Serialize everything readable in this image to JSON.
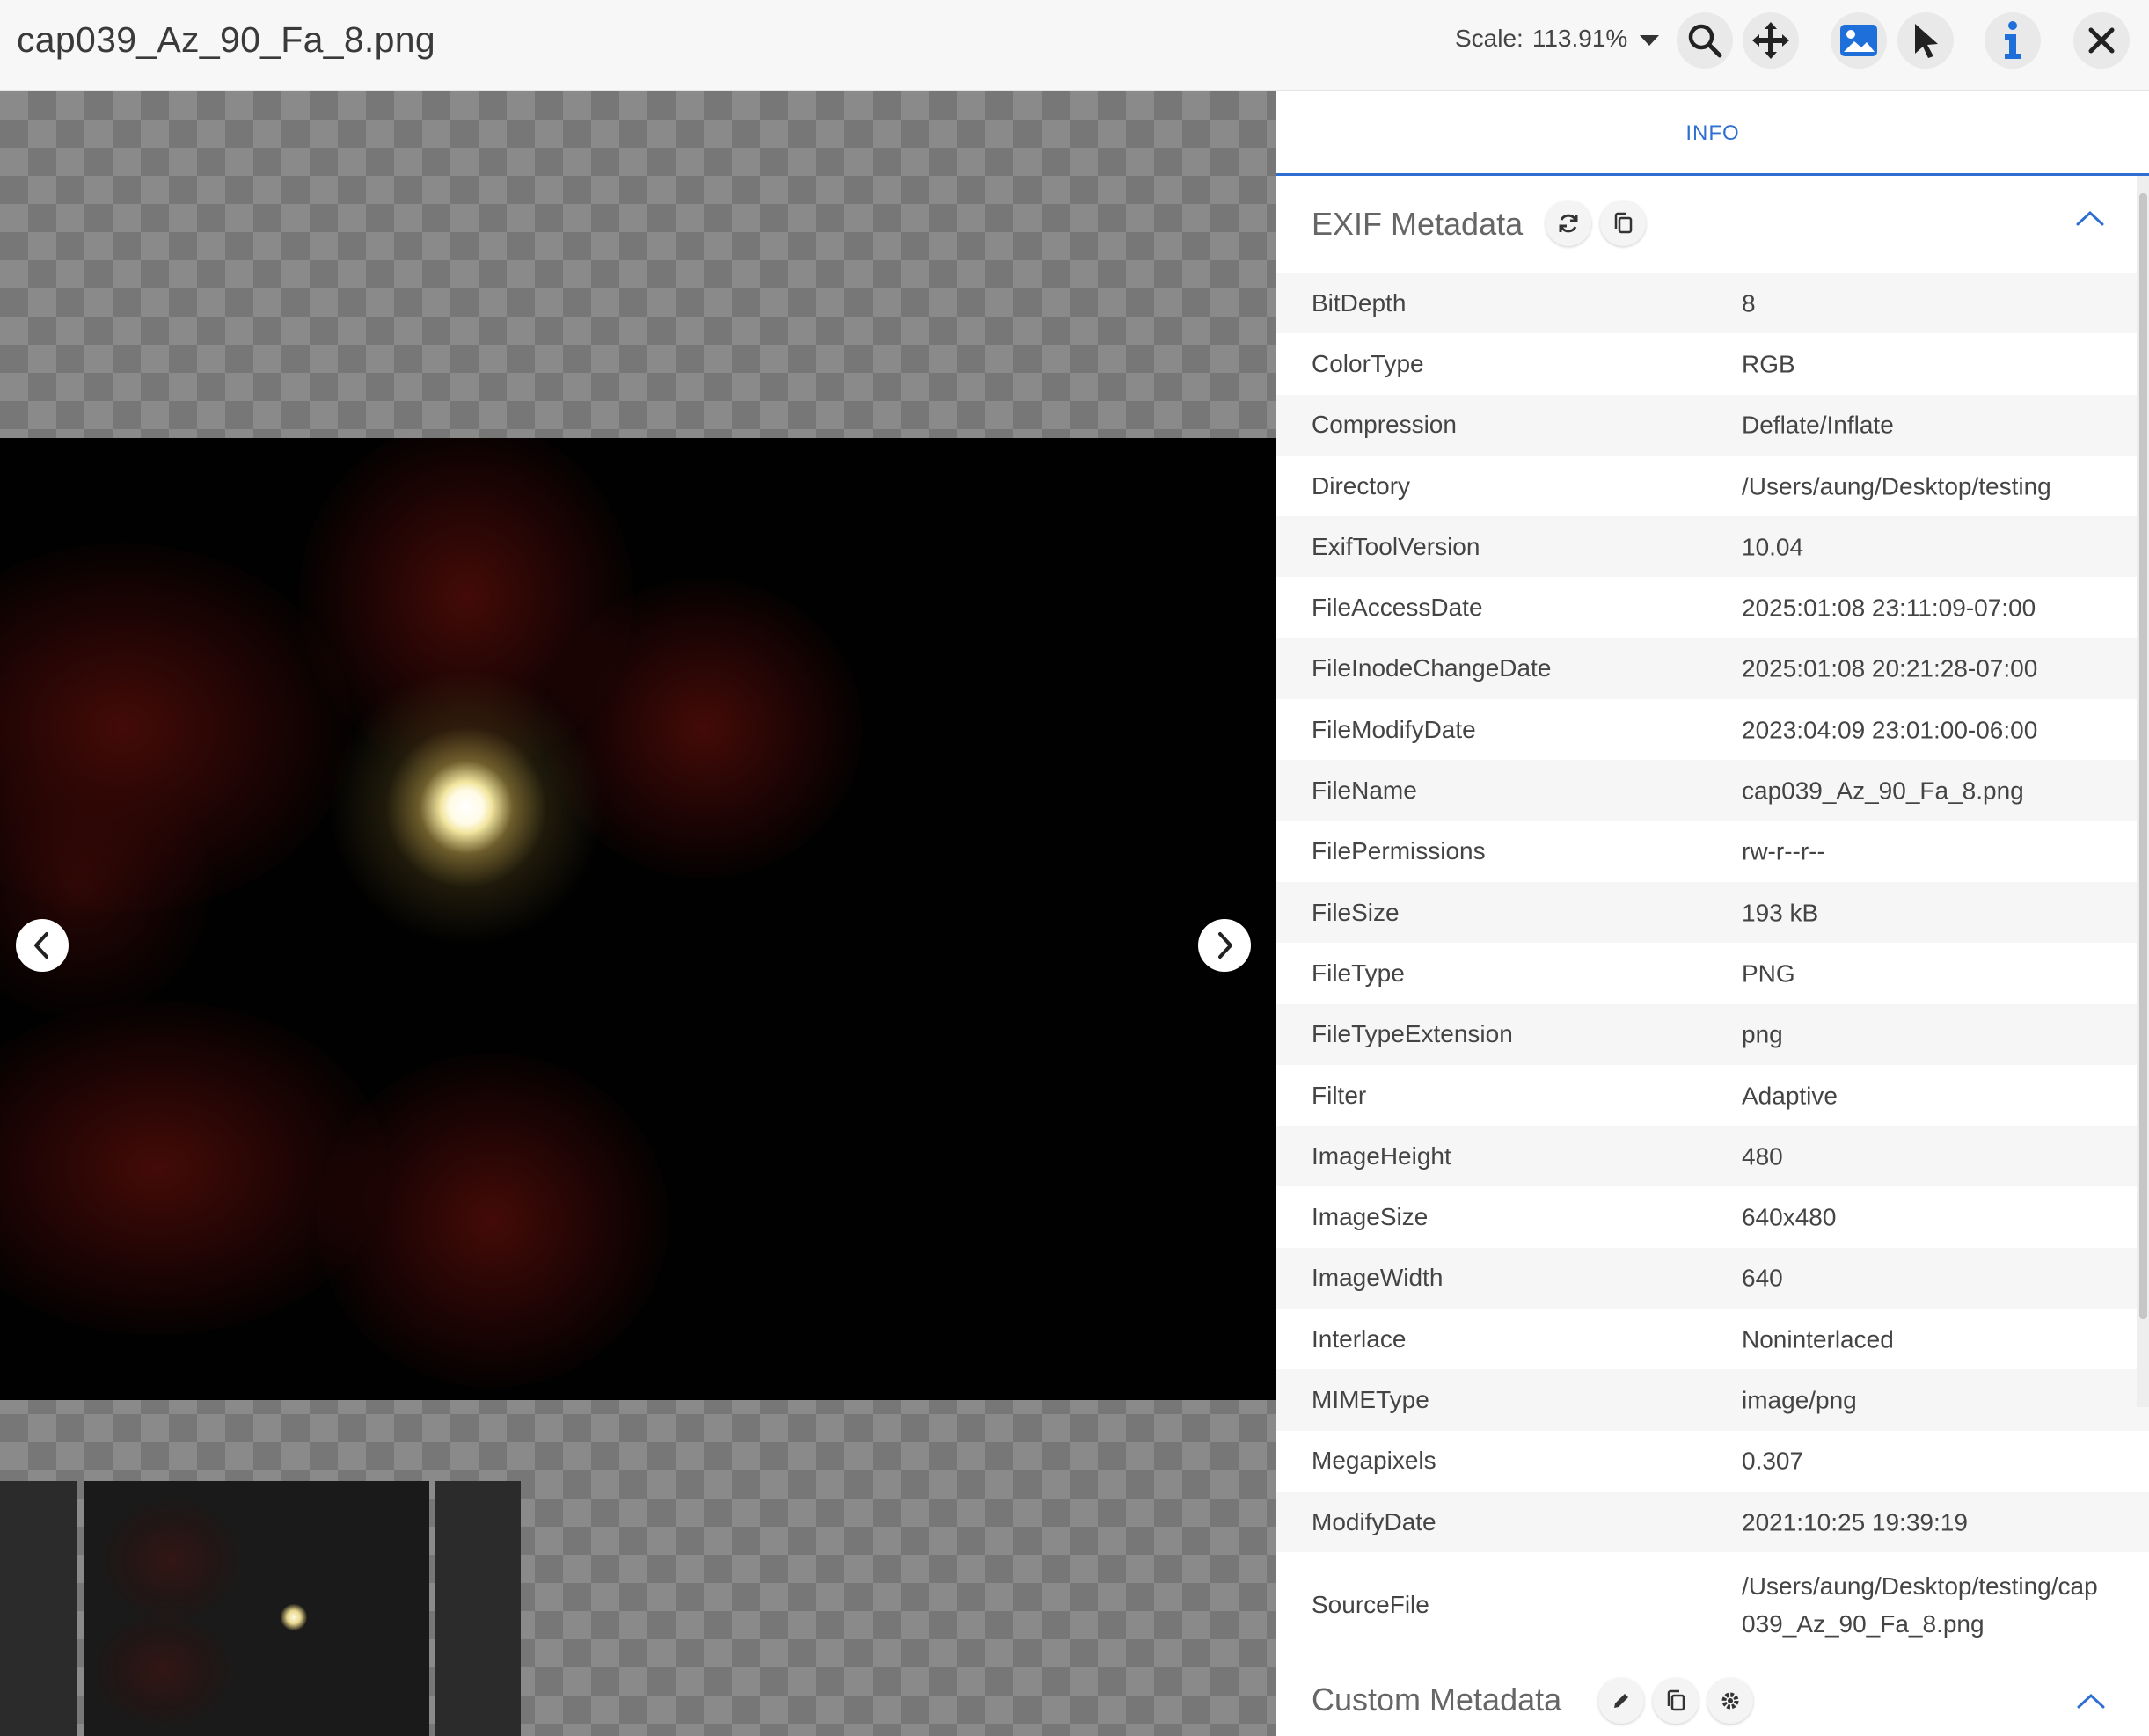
{
  "header": {
    "title": "cap039_Az_90_Fa_8.png",
    "scale_label": "Scale:",
    "scale_value": "113.91%",
    "tools": [
      "search-icon",
      "move-icon",
      "image-icon",
      "pointer-icon",
      "info-icon",
      "close-icon"
    ]
  },
  "panel": {
    "tab_label": "INFO",
    "exif_title": "EXIF Metadata",
    "custom_title": "Custom Metadata",
    "rows": [
      {
        "key": "BitDepth",
        "value": "8"
      },
      {
        "key": "ColorType",
        "value": "RGB"
      },
      {
        "key": "Compression",
        "value": "Deflate/Inflate"
      },
      {
        "key": "Directory",
        "value": "/Users/aung/Desktop/testing"
      },
      {
        "key": "ExifToolVersion",
        "value": "10.04"
      },
      {
        "key": "FileAccessDate",
        "value": "2025:01:08 23:11:09-07:00"
      },
      {
        "key": "FileInodeChangeDate",
        "value": "2025:01:08 20:21:28-07:00"
      },
      {
        "key": "FileModifyDate",
        "value": "2023:04:09 23:01:00-06:00"
      },
      {
        "key": "FileName",
        "value": "cap039_Az_90_Fa_8.png"
      },
      {
        "key": "FilePermissions",
        "value": "rw-r--r--"
      },
      {
        "key": "FileSize",
        "value": "193 kB"
      },
      {
        "key": "FileType",
        "value": "PNG"
      },
      {
        "key": "FileTypeExtension",
        "value": "png"
      },
      {
        "key": "Filter",
        "value": "Adaptive"
      },
      {
        "key": "ImageHeight",
        "value": "480"
      },
      {
        "key": "ImageSize",
        "value": "640x480"
      },
      {
        "key": "ImageWidth",
        "value": "640"
      },
      {
        "key": "Interlace",
        "value": "Noninterlaced"
      },
      {
        "key": "MIMEType",
        "value": "image/png"
      },
      {
        "key": "Megapixels",
        "value": "0.307"
      },
      {
        "key": "ModifyDate",
        "value": "2021:10:25 19:39:19"
      },
      {
        "key": "SourceFile",
        "value": "/Users/aung/Desktop/testing/cap039_Az_90_Fa_8.png"
      }
    ]
  },
  "colors": {
    "accent": "#2f6fd1",
    "tool_blue": "#1e6fd9"
  }
}
